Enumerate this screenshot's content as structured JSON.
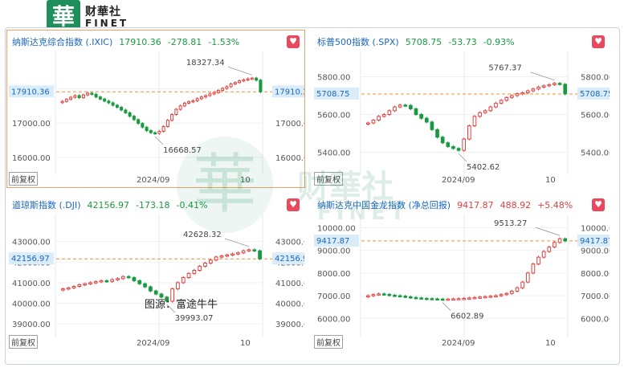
{
  "logo": {
    "glyph": "華",
    "brand": "财華社",
    "sub": "FINET"
  },
  "watermark": {
    "glyph": "華",
    "text": "财華社",
    "sub": "FINET"
  },
  "caption": "图源：富途牛牛",
  "colors": {
    "up": "#e34040",
    "down": "#1a9a40",
    "ref_line": "#f09030"
  },
  "panels": [
    {
      "name": "纳斯达克综合指数 (.IXIC)",
      "price": "17910.36",
      "change": "-278.81",
      "pct": "-1.53%",
      "direction": "down",
      "active": true,
      "fq": "前复权",
      "date_label": "2024/09",
      "tick_10": "10",
      "label_left": "17910.36",
      "label_right": "17910.36"
    },
    {
      "name": "标普500指数 (.SPX)",
      "price": "5708.75",
      "change": "-53.73",
      "pct": "-0.93%",
      "direction": "down",
      "active": false,
      "fq": "前复权",
      "date_label": "2024/09",
      "tick_10": "10",
      "label_left": "5708.75",
      "label_right": "5708.75"
    },
    {
      "name": "道琼斯指数 (.DJI)",
      "price": "42156.97",
      "change": "-173.18",
      "pct": "-0.41%",
      "direction": "down",
      "active": false,
      "fq": "前复权",
      "date_label": "2024/09",
      "tick_10": "10",
      "label_left": "42156.97",
      "label_right": "42156.97"
    },
    {
      "name": "纳斯达克中国金龙指数 (净总回报)",
      "price": "9417.87",
      "change": "488.92",
      "pct": "+5.48%",
      "direction": "up",
      "active": false,
      "fq": "前复权",
      "date_label": "2024/09",
      "tick_10": "10",
      "label_left": "9417.87",
      "label_right": "9417.87"
    }
  ],
  "chart_data": [
    {
      "type": "candlestick",
      "title": "纳斯达克综合指数 (.IXIC)",
      "ylim": [
        15600,
        18900
      ],
      "y_ticks": [
        16000,
        17000,
        18000
      ],
      "last": 17910.36,
      "max_label": 18327.34,
      "min_label": 16668.57,
      "closes": [
        17630,
        17690,
        17750,
        17800,
        17740,
        17820,
        17870,
        17840,
        17760,
        17700,
        17640,
        17590,
        17520,
        17460,
        17380,
        17300,
        17200,
        17100,
        16990,
        16880,
        16780,
        16720,
        16700,
        16760,
        16900,
        17080,
        17250,
        17400,
        17500,
        17580,
        17620,
        17650,
        17710,
        17760,
        17800,
        17850,
        17890,
        17950,
        18010,
        18060,
        18140,
        18180,
        18230,
        18260,
        18290,
        18310,
        18250,
        17910.36
      ]
    },
    {
      "type": "candlestick",
      "title": "标普500指数 (.SPX)",
      "ylim": [
        5300,
        5900
      ],
      "y_ticks": [
        5400,
        5600,
        5800
      ],
      "last": 5708.75,
      "max_label": 5767.37,
      "min_label": 5402.62,
      "closes": [
        5555,
        5570,
        5590,
        5600,
        5620,
        5640,
        5650,
        5648,
        5630,
        5600,
        5580,
        5560,
        5520,
        5480,
        5450,
        5430,
        5420,
        5410,
        5470,
        5540,
        5590,
        5610,
        5620,
        5640,
        5660,
        5675,
        5690,
        5700,
        5710,
        5715,
        5725,
        5735,
        5745,
        5752,
        5758,
        5765,
        5760,
        5708.75
      ]
    },
    {
      "type": "candlestick",
      "title": "道琼斯指数 (.DJI)",
      "ylim": [
        38500,
        44000
      ],
      "y_ticks": [
        39000,
        40000,
        41000,
        42000,
        43000
      ],
      "last": 42156.97,
      "max_label": 42628.32,
      "min_label": 39993.07,
      "closes": [
        40700,
        40750,
        40820,
        40900,
        40950,
        41000,
        41050,
        41100,
        41060,
        41150,
        41200,
        41300,
        41250,
        41100,
        40950,
        40800,
        40600,
        40450,
        40300,
        40100,
        40700,
        41000,
        41250,
        41450,
        41600,
        41800,
        41950,
        42100,
        42250,
        42300,
        42350,
        42400,
        42450,
        42550,
        42600,
        42550,
        42156.97
      ]
    },
    {
      "type": "candlestick",
      "title": "纳斯达克中国金龙指数 (净总回报)",
      "ylim": [
        5300,
        10300
      ],
      "y_ticks": [
        6000,
        7000,
        8000,
        9000,
        10000
      ],
      "last": 9417.87,
      "max_label": 9513.27,
      "min_label": 6602.89,
      "closes": [
        7000,
        7050,
        7080,
        7060,
        7020,
        7000,
        6980,
        6950,
        6920,
        6900,
        6880,
        6870,
        6860,
        6850,
        6840,
        6850,
        6860,
        6870,
        6880,
        6900,
        6920,
        6940,
        6960,
        6980,
        7000,
        7050,
        7100,
        7200,
        7350,
        7600,
        8000,
        8400,
        8700,
        8950,
        9150,
        9350,
        9513.27,
        9417.87
      ]
    }
  ]
}
